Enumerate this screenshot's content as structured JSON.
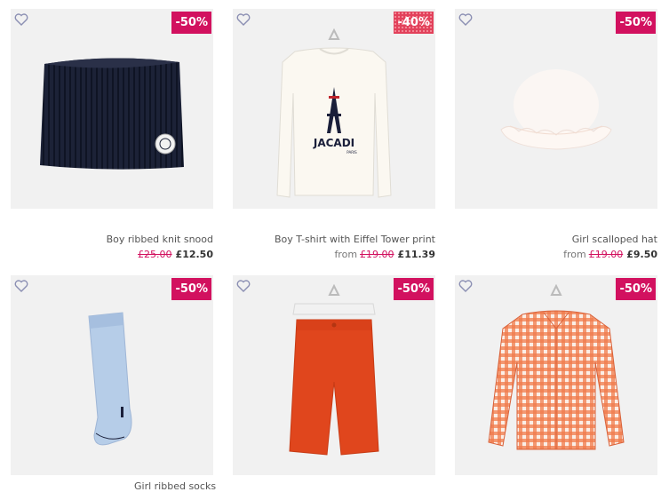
{
  "products": [
    {
      "name": "Boy ribbed knit snood",
      "from_label": "",
      "old_price": "£25.00",
      "new_price": "£12.50",
      "discount": "-50%",
      "icon": "heart-outline"
    },
    {
      "name": "Boy T-shirt with Eiffel Tower print",
      "from_label": "from",
      "old_price": "£19.00",
      "new_price": "£11.39",
      "discount": "-40%",
      "icon": "heart-outline",
      "print_text": "JACADI",
      "print_sub": "PARIS"
    },
    {
      "name": "Girl scalloped hat",
      "from_label": "from",
      "old_price": "£19.00",
      "new_price": "£9.50",
      "discount": "-50%",
      "icon": "heart-outline"
    },
    {
      "name": "Girl ribbed socks",
      "discount": "-50%",
      "icon": "heart-outline"
    },
    {
      "name": "",
      "discount": "-50%",
      "icon": "heart-outline"
    },
    {
      "name": "",
      "discount": "-50%",
      "icon": "heart-outline"
    }
  ],
  "colors": {
    "badge": "#d2115f",
    "old_price": "#d2115f",
    "tile_bg": "#f1f1f1"
  }
}
